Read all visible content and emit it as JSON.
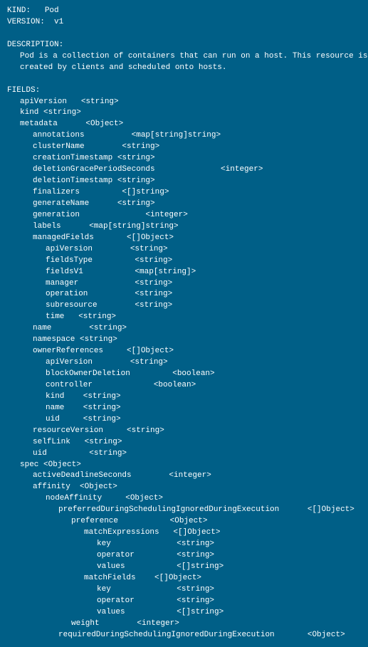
{
  "header": {
    "kind_label": "KIND:",
    "kind_value": "Pod",
    "version_label": "VERSION:",
    "version_value": "v1"
  },
  "description": {
    "label": "DESCRIPTION:",
    "lines": [
      "Pod is a collection of containers that can run on a host. This resource is",
      "created by clients and scheduled onto hosts."
    ]
  },
  "fields": {
    "label": "FIELDS:",
    "items": [
      {
        "indent": 1,
        "text": "apiVersion   <string>"
      },
      {
        "indent": 1,
        "text": "kind <string>"
      },
      {
        "indent": 1,
        "text": "metadata      <Object>"
      },
      {
        "indent": 2,
        "text": "annotations          <map[string]string>"
      },
      {
        "indent": 2,
        "text": "clusterName        <string>"
      },
      {
        "indent": 2,
        "text": "creationTimestamp <string>"
      },
      {
        "indent": 2,
        "text": "deletionGracePeriodSeconds              <integer>"
      },
      {
        "indent": 2,
        "text": "deletionTimestamp <string>"
      },
      {
        "indent": 2,
        "text": "finalizers         <[]string>"
      },
      {
        "indent": 2,
        "text": "generateName      <string>"
      },
      {
        "indent": 2,
        "text": "generation              <integer>"
      },
      {
        "indent": 2,
        "text": "labels      <map[string]string>"
      },
      {
        "indent": 2,
        "text": "managedFields       <[]Object>"
      },
      {
        "indent": 3,
        "text": "apiVersion        <string>"
      },
      {
        "indent": 3,
        "text": "fieldsType         <string>"
      },
      {
        "indent": 3,
        "text": "fieldsV1           <map[string]>"
      },
      {
        "indent": 3,
        "text": "manager            <string>"
      },
      {
        "indent": 3,
        "text": "operation          <string>"
      },
      {
        "indent": 3,
        "text": "subresource        <string>"
      },
      {
        "indent": 3,
        "text": "time   <string>"
      },
      {
        "indent": 2,
        "text": "name        <string>"
      },
      {
        "indent": 2,
        "text": "namespace <string>"
      },
      {
        "indent": 2,
        "text": "ownerReferences     <[]Object>"
      },
      {
        "indent": 3,
        "text": "apiVersion        <string>"
      },
      {
        "indent": 3,
        "text": "blockOwnerDeletion         <boolean>"
      },
      {
        "indent": 3,
        "text": "controller             <boolean>"
      },
      {
        "indent": 3,
        "text": "kind    <string>"
      },
      {
        "indent": 3,
        "text": "name    <string>"
      },
      {
        "indent": 3,
        "text": "uid     <string>"
      },
      {
        "indent": 2,
        "text": "resourceVersion     <string>"
      },
      {
        "indent": 2,
        "text": "selfLink   <string>"
      },
      {
        "indent": 2,
        "text": "uid         <string>"
      },
      {
        "indent": 1,
        "text": "spec <Object>"
      },
      {
        "indent": 2,
        "text": "activeDeadlineSeconds        <integer>"
      },
      {
        "indent": 2,
        "text": "affinity  <Object>"
      },
      {
        "indent": 3,
        "text": "nodeAffinity     <Object>"
      },
      {
        "indent": 4,
        "text": "preferredDuringSchedulingIgnoredDuringExecution      <[]Object>"
      },
      {
        "indent": 5,
        "text": "preference           <Object>"
      },
      {
        "indent": 6,
        "text": "matchExpressions   <[]Object>"
      },
      {
        "indent": 7,
        "text": "key              <string>"
      },
      {
        "indent": 7,
        "text": "operator         <string>"
      },
      {
        "indent": 7,
        "text": "values           <[]string>"
      },
      {
        "indent": 6,
        "text": "matchFields    <[]Object>"
      },
      {
        "indent": 7,
        "text": "key              <string>"
      },
      {
        "indent": 7,
        "text": "operator         <string>"
      },
      {
        "indent": 7,
        "text": "values           <[]string>"
      },
      {
        "indent": 5,
        "text": "weight        <integer>"
      },
      {
        "indent": 4,
        "text": "requiredDuringSchedulingIgnoredDuringExecution       <Object>"
      }
    ]
  }
}
